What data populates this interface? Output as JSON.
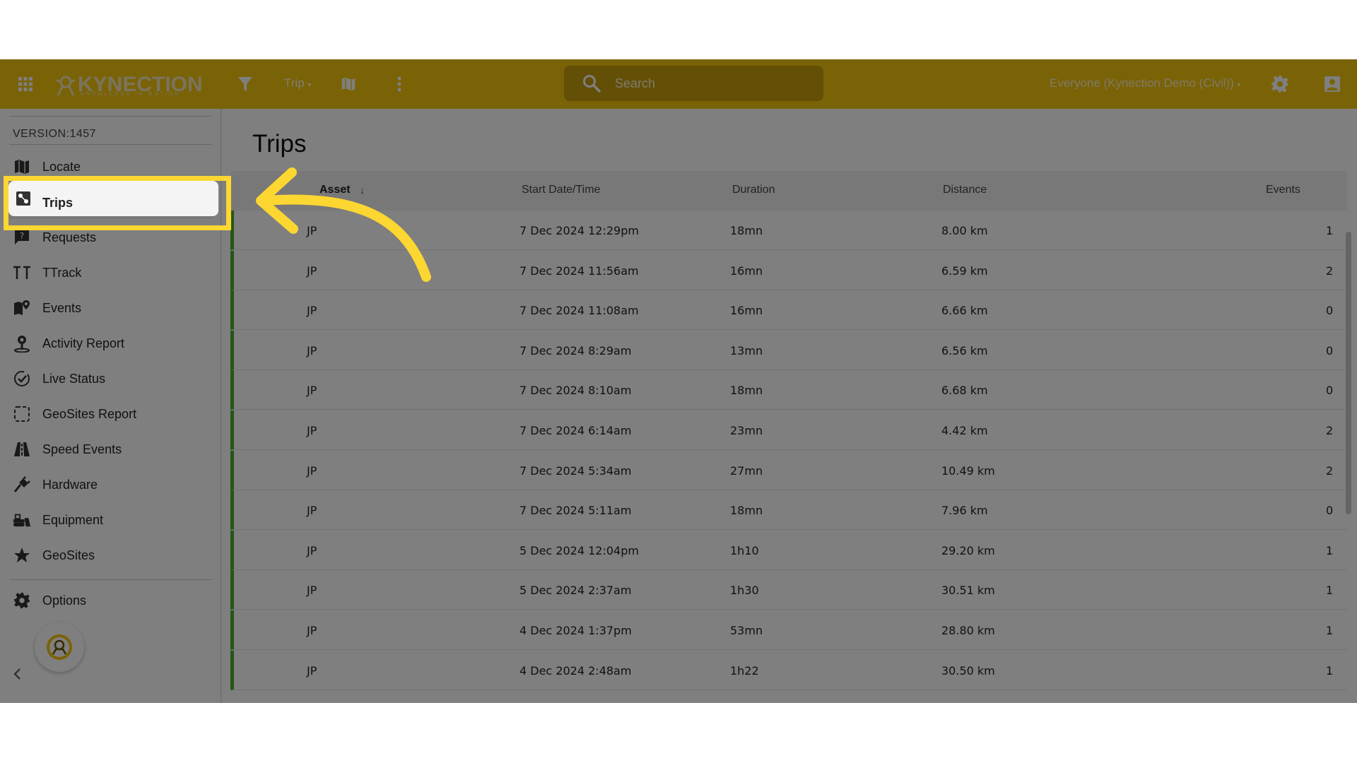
{
  "colors": {
    "brand": "#f5c50e",
    "accent": "#fcd631",
    "trip_bar": "#4caf2a"
  },
  "topbar": {
    "logo_text": "KYNECTION",
    "logo_tagline": "KNOWLEDGE IN MOTION",
    "trip_menu_label": "Trip",
    "search_placeholder": "Search",
    "scope_label": "Everyone (Kynection Demo (Civil))"
  },
  "sidebar": {
    "version": "VERSION:1457",
    "items": [
      {
        "label": "Locate",
        "icon": "map-icon"
      },
      {
        "label": "Trips",
        "icon": "trips-icon"
      },
      {
        "label": "Requests",
        "icon": "help-chat-icon"
      },
      {
        "label": "TTrack",
        "icon": "tt-icon"
      },
      {
        "label": "Events",
        "icon": "map-pin-icon"
      },
      {
        "label": "Activity Report",
        "icon": "person-pin-icon"
      },
      {
        "label": "Live Status",
        "icon": "check-circle-icon"
      },
      {
        "label": "GeoSites Report",
        "icon": "dashed-square-icon"
      },
      {
        "label": "Speed Events",
        "icon": "road-icon"
      },
      {
        "label": "Hardware",
        "icon": "plug-icon"
      },
      {
        "label": "Equipment",
        "icon": "bulldozer-icon"
      },
      {
        "label": "GeoSites",
        "icon": "star-icon"
      }
    ],
    "options_label": "Options"
  },
  "main": {
    "title": "Trips",
    "columns": {
      "asset": "Asset",
      "start": "Start Date/Time",
      "duration": "Duration",
      "distance": "Distance",
      "events": "Events"
    },
    "rows": [
      {
        "asset": "JP",
        "start": "7 Dec 2024 12:29pm",
        "duration": "18mn",
        "distance": "8.00 km",
        "events": "1"
      },
      {
        "asset": "JP",
        "start": "7 Dec 2024 11:56am",
        "duration": "16mn",
        "distance": "6.59 km",
        "events": "2"
      },
      {
        "asset": "JP",
        "start": "7 Dec 2024 11:08am",
        "duration": "16mn",
        "distance": "6.66 km",
        "events": "0"
      },
      {
        "asset": "JP",
        "start": "7 Dec 2024 8:29am",
        "duration": "13mn",
        "distance": "6.56 km",
        "events": "0"
      },
      {
        "asset": "JP",
        "start": "7 Dec 2024 8:10am",
        "duration": "18mn",
        "distance": "6.68 km",
        "events": "0"
      },
      {
        "asset": "JP",
        "start": "7 Dec 2024 6:14am",
        "duration": "23mn",
        "distance": "4.42 km",
        "events": "2"
      },
      {
        "asset": "JP",
        "start": "7 Dec 2024 5:34am",
        "duration": "27mn",
        "distance": "10.49 km",
        "events": "2"
      },
      {
        "asset": "JP",
        "start": "7 Dec 2024 5:11am",
        "duration": "18mn",
        "distance": "7.96 km",
        "events": "0"
      },
      {
        "asset": "JP",
        "start": "5 Dec 2024 12:04pm",
        "duration": "1h10",
        "distance": "29.20 km",
        "events": "1"
      },
      {
        "asset": "JP",
        "start": "5 Dec 2024 2:37am",
        "duration": "1h30",
        "distance": "30.51 km",
        "events": "1"
      },
      {
        "asset": "JP",
        "start": "4 Dec 2024 1:37pm",
        "duration": "53mn",
        "distance": "28.80 km",
        "events": "1"
      },
      {
        "asset": "JP",
        "start": "4 Dec 2024 2:48am",
        "duration": "1h22",
        "distance": "30.50 km",
        "events": "1"
      }
    ]
  }
}
